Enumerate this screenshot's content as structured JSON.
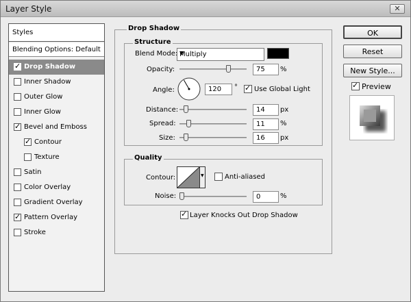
{
  "window": {
    "title": "Layer Style",
    "close_glyph": "✕"
  },
  "styles_panel": {
    "header": "Styles",
    "blending_options": "Blending Options: Default",
    "items": [
      {
        "label": "Drop Shadow",
        "checked": true,
        "selected": true,
        "sub": false
      },
      {
        "label": "Inner Shadow",
        "checked": false,
        "selected": false,
        "sub": false
      },
      {
        "label": "Outer Glow",
        "checked": false,
        "selected": false,
        "sub": false
      },
      {
        "label": "Inner Glow",
        "checked": false,
        "selected": false,
        "sub": false
      },
      {
        "label": "Bevel and Emboss",
        "checked": true,
        "selected": false,
        "sub": false
      },
      {
        "label": "Contour",
        "checked": true,
        "selected": false,
        "sub": true
      },
      {
        "label": "Texture",
        "checked": false,
        "selected": false,
        "sub": true
      },
      {
        "label": "Satin",
        "checked": false,
        "selected": false,
        "sub": false
      },
      {
        "label": "Color Overlay",
        "checked": false,
        "selected": false,
        "sub": false
      },
      {
        "label": "Gradient Overlay",
        "checked": false,
        "selected": false,
        "sub": false
      },
      {
        "label": "Pattern Overlay",
        "checked": true,
        "selected": false,
        "sub": false
      },
      {
        "label": "Stroke",
        "checked": false,
        "selected": false,
        "sub": false
      }
    ]
  },
  "drop_shadow": {
    "title": "Drop Shadow",
    "structure": {
      "title": "Structure",
      "blend_mode_label": "Blend Mode:",
      "blend_mode_value": "Multiply",
      "shadow_color": "#000000",
      "opacity_label": "Opacity:",
      "opacity_value": "75",
      "opacity_unit": "%",
      "opacity_fraction": 0.75,
      "angle_label": "Angle:",
      "angle_value": "120",
      "angle_unit": "°",
      "use_global_light_label": "Use Global Light",
      "use_global_light_checked": true,
      "distance_label": "Distance:",
      "distance_value": "14",
      "distance_unit": "px",
      "distance_fraction": 0.07,
      "spread_label": "Spread:",
      "spread_value": "11",
      "spread_unit": "%",
      "spread_fraction": 0.11,
      "size_label": "Size:",
      "size_value": "16",
      "size_unit": "px",
      "size_fraction": 0.07
    },
    "quality": {
      "title": "Quality",
      "contour_label": "Contour:",
      "anti_aliased_label": "Anti-aliased",
      "anti_aliased_checked": false,
      "noise_label": "Noise:",
      "noise_value": "0",
      "noise_unit": "%",
      "noise_fraction": 0.0
    },
    "knocks_out_label": "Layer Knocks Out Drop Shadow",
    "knocks_out_checked": true
  },
  "buttons": {
    "ok": "OK",
    "reset": "Reset",
    "new_style": "New Style...",
    "preview_label": "Preview",
    "preview_checked": true
  }
}
